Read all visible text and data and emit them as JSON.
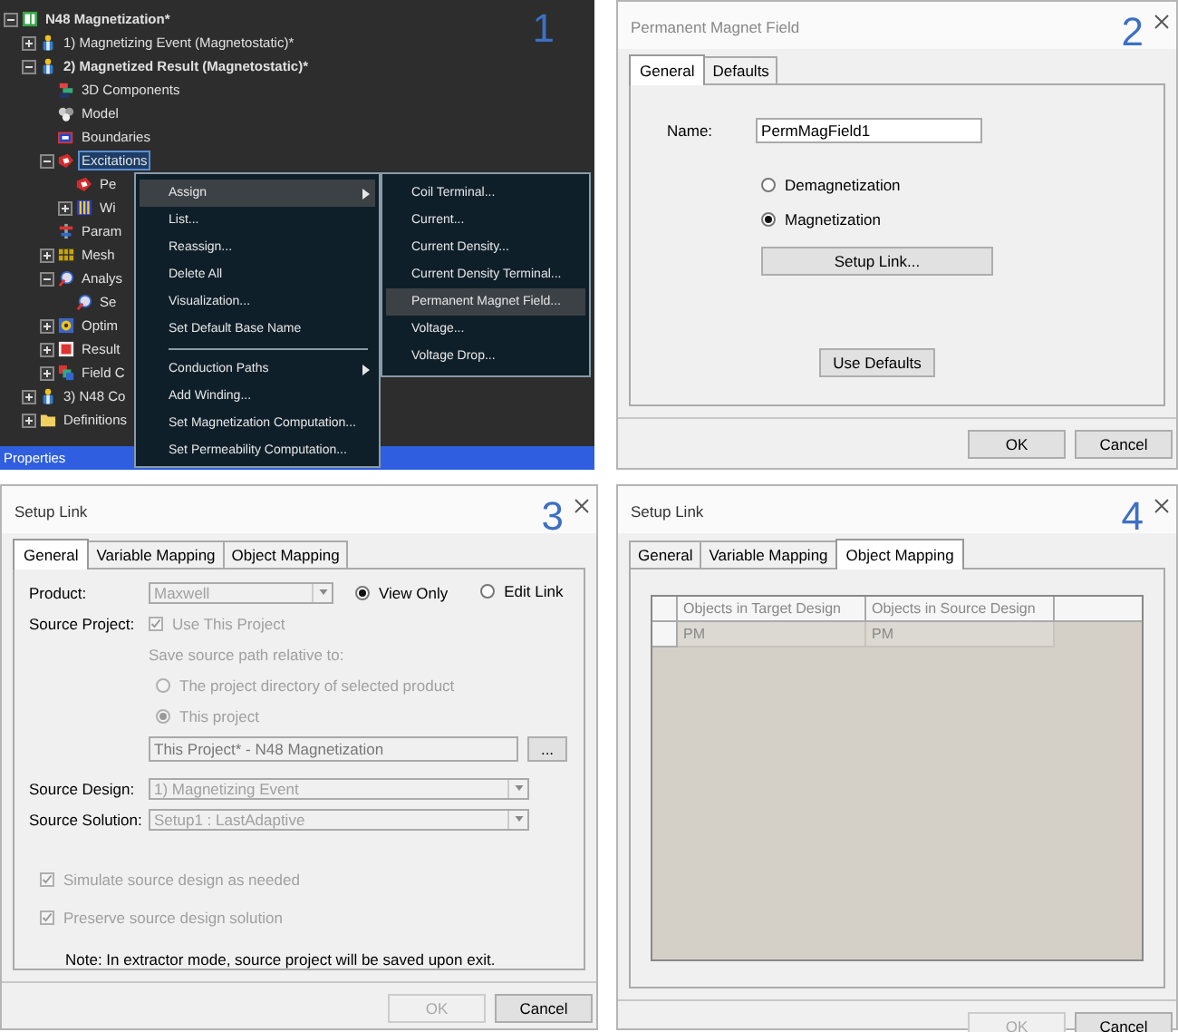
{
  "tree_panel": {
    "label": "1",
    "tree": [
      {
        "text": "N48 Magnetization*",
        "kind": "project",
        "bold": true,
        "selected": false,
        "expanded": true,
        "children": [
          {
            "text": "1) Magnetizing Event (Magnetostatic)*",
            "kind": "design",
            "bold": false,
            "selected": false,
            "expanded": false
          },
          {
            "text": "2) Magnetized Result (Magnetostatic)*",
            "kind": "design",
            "bold": true,
            "selected": false,
            "expanded": true,
            "children": [
              {
                "text": "3D Components",
                "kind": "component",
                "bold": false,
                "selected": false
              },
              {
                "text": "Model",
                "kind": "model",
                "bold": false,
                "selected": false
              },
              {
                "text": "Boundaries",
                "kind": "boundary",
                "bold": false,
                "selected": false
              },
              {
                "text": "Excitations",
                "kind": "excitation",
                "bold": false,
                "selected": true,
                "expanded": true,
                "children": [
                  {
                    "text": "Pe",
                    "kind": "excitation",
                    "bold": false,
                    "selected": false
                  },
                  {
                    "text": "Wi",
                    "kind": "winding",
                    "bold": false,
                    "selected": false,
                    "expanded": false
                  }
                ]
              },
              {
                "text": "Param",
                "kind": "parameter",
                "bold": false,
                "selected": false
              },
              {
                "text": "Mesh",
                "kind": "mesh",
                "bold": false,
                "selected": false,
                "expanded": false
              },
              {
                "text": "Analys",
                "kind": "analysis",
                "bold": false,
                "selected": false,
                "expanded": true,
                "children": [
                  {
                    "text": "Se",
                    "kind": "analysis",
                    "bold": false,
                    "selected": false
                  }
                ]
              },
              {
                "text": "Optim",
                "kind": "optimetrics",
                "bold": false,
                "selected": false,
                "expanded": false
              },
              {
                "text": "Result",
                "kind": "results",
                "bold": false,
                "selected": false,
                "expanded": false
              },
              {
                "text": "Field C",
                "kind": "field",
                "bold": false,
                "selected": false,
                "expanded": false
              }
            ]
          },
          {
            "text": "3) N48 Co",
            "kind": "design",
            "bold": false,
            "selected": false,
            "expanded": false
          },
          {
            "text": "Definitions",
            "kind": "folder",
            "bold": false,
            "selected": false,
            "expanded": false
          }
        ]
      }
    ],
    "status_bar": "Properties",
    "context_menu": [
      {
        "kind": "item",
        "text": "Assign",
        "selected": true,
        "submenu": true
      },
      {
        "kind": "item",
        "text": "List...",
        "selected": false,
        "submenu": false
      },
      {
        "kind": "item",
        "text": "Reassign...",
        "selected": false,
        "submenu": false
      },
      {
        "kind": "item",
        "text": "Delete All",
        "selected": false,
        "submenu": false
      },
      {
        "kind": "item",
        "text": "Visualization...",
        "selected": false,
        "submenu": false
      },
      {
        "kind": "item",
        "text": "Set Default Base Name",
        "selected": false,
        "submenu": false
      },
      {
        "kind": "separator"
      },
      {
        "kind": "item",
        "text": "Conduction Paths",
        "selected": false,
        "submenu": true
      },
      {
        "kind": "item",
        "text": "Add Winding...",
        "selected": false,
        "submenu": false
      },
      {
        "kind": "item",
        "text": "Set Magnetization Computation...",
        "selected": false,
        "submenu": false
      },
      {
        "kind": "item",
        "text": "Set Permeability Computation...",
        "selected": false,
        "submenu": false
      }
    ],
    "submenu": [
      {
        "text": "Coil Terminal...",
        "selected": false
      },
      {
        "text": "Current...",
        "selected": false
      },
      {
        "text": "Current Density...",
        "selected": false
      },
      {
        "text": "Current Density Terminal...",
        "selected": false
      },
      {
        "text": "Permanent Magnet Field...",
        "selected": true
      },
      {
        "text": "Voltage...",
        "selected": false
      },
      {
        "text": "Voltage Drop...",
        "selected": false
      }
    ]
  },
  "magnet_dialog": {
    "label": "2",
    "title": "Permanent Magnet Field",
    "tabs": [
      {
        "label": "General",
        "selected": true
      },
      {
        "label": "Defaults",
        "selected": false
      }
    ],
    "name_label": "Name:",
    "name_value": "PermMagField1",
    "options": [
      {
        "label": "Demagnetization",
        "selected": false
      },
      {
        "label": "Magnetization",
        "selected": true
      }
    ],
    "setup_button": "Setup Link...",
    "defaults_button": "Use Defaults",
    "buttons": [
      {
        "label": "OK",
        "disabled": false
      },
      {
        "label": "Cancel",
        "disabled": false
      }
    ]
  },
  "link_dialog_general": {
    "label": "3",
    "title": "Setup Link",
    "tabs": [
      {
        "label": "General",
        "selected": true
      },
      {
        "label": "Variable Mapping",
        "selected": false
      },
      {
        "label": "Object Mapping",
        "selected": false
      }
    ],
    "product": {
      "label": "Product:",
      "value": "Maxwell",
      "disabled": true
    },
    "mode": [
      {
        "label": "View Only",
        "selected": true,
        "disabled": false
      },
      {
        "label": "Edit Link",
        "selected": false,
        "disabled": false
      }
    ],
    "source_project": {
      "label": "Source Project:",
      "checkbox": {
        "label": "Use This Project",
        "checked": true,
        "disabled": true
      },
      "path_caption": "Save source path relative to:",
      "path_options": [
        {
          "label": "The project directory of selected product",
          "selected": false,
          "disabled": true
        },
        {
          "label": "This project",
          "selected": true,
          "disabled": true
        }
      ],
      "project_field": "This Project* - N48 Magnetization",
      "browse_button": "..."
    },
    "source_design": {
      "label": "Source Design:",
      "value": "1) Magnetizing Event",
      "disabled": true
    },
    "source_solution": {
      "label": "Source Solution:",
      "value": "Setup1 : LastAdaptive",
      "disabled": true
    },
    "options": [
      {
        "label": "Simulate source design as needed",
        "checked": true,
        "disabled": true
      },
      {
        "label": "Preserve source design solution",
        "checked": true,
        "disabled": true
      }
    ],
    "note": "Note: In extractor mode, source project will be saved upon exit.",
    "buttons": [
      {
        "label": "OK",
        "disabled": true
      },
      {
        "label": "Cancel",
        "disabled": false
      }
    ]
  },
  "link_dialog_objects": {
    "label": "4",
    "title": "Setup Link",
    "tabs": [
      {
        "label": "General",
        "selected": false
      },
      {
        "label": "Variable Mapping",
        "selected": false
      },
      {
        "label": "Object Mapping",
        "selected": true
      }
    ],
    "table": {
      "columns": [
        "Objects in Target Design",
        "Objects in Source Design"
      ],
      "rows": [
        [
          "PM",
          "PM"
        ]
      ]
    },
    "buttons": [
      {
        "label": "OK",
        "disabled": true
      },
      {
        "label": "Cancel",
        "disabled": false
      }
    ]
  }
}
